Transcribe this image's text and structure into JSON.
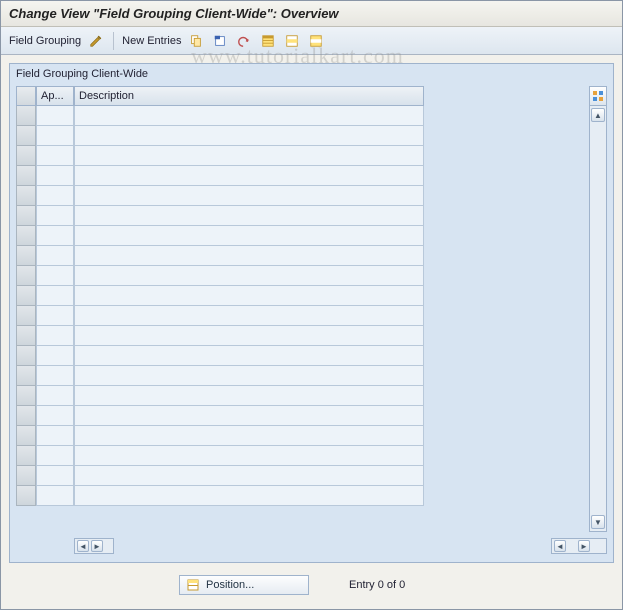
{
  "window": {
    "title": "Change View \"Field Grouping Client-Wide\": Overview"
  },
  "toolbar": {
    "field_grouping_label": "Field Grouping",
    "new_entries_label": "New Entries",
    "icons": {
      "glasses": "toggle-display-change",
      "copy": "copy-as",
      "delete": "delete",
      "undo": "undo-change",
      "select_all": "select-all",
      "select_block": "select-block",
      "deselect_all": "deselect-all"
    }
  },
  "panel": {
    "group_label": "Field Grouping Client-Wide"
  },
  "grid": {
    "columns": {
      "ap": "Ap...",
      "description": "Description"
    },
    "row_count": 20,
    "config_tooltip": "Configuration"
  },
  "hscroll": {
    "left": "◄",
    "right": "►"
  },
  "vscroll": {
    "up": "▲",
    "down": "▼"
  },
  "footer": {
    "position_label": "Position...",
    "entry_text": "Entry 0 of 0"
  },
  "watermark": "www.tutorialkart.com"
}
